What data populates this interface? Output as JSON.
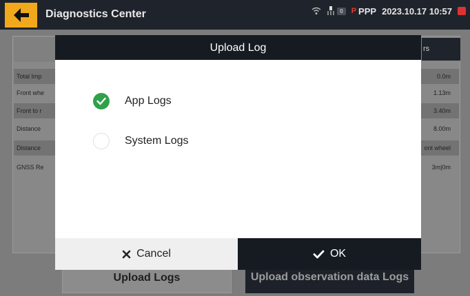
{
  "header": {
    "title": "Diagnostics Center",
    "sat_count": "0",
    "mode": "PPP",
    "ppp_mark": "P",
    "datetime": "2023.10.17 10:57"
  },
  "background": {
    "header_right": "rs",
    "rows": [
      {
        "label": "Total Imp",
        "value": "0.0m"
      },
      {
        "label": "Front whe",
        "value": "1.13m"
      },
      {
        "label": "Front to r",
        "value": "3.40m"
      },
      {
        "label": "Distance",
        "value": "8.00m"
      },
      {
        "label": "Distance",
        "value": "ont wheel"
      },
      {
        "label": "GNSS Re",
        "value": "3m|0m"
      }
    ],
    "upload_logs": "Upload Logs",
    "upload_observation": "Upload observation data Logs"
  },
  "dialog": {
    "title": "Upload Log",
    "options": [
      {
        "label": "App Logs",
        "checked": true
      },
      {
        "label": "System Logs",
        "checked": false
      }
    ],
    "cancel_label": "Cancel",
    "ok_label": "OK"
  },
  "colors": {
    "accent": "#f2a81d",
    "dark": "#161b22",
    "check": "#2fa24a",
    "record": "#dd3333"
  },
  "icons": {
    "back": "arrow-left-icon",
    "wifi": "wifi-icon",
    "satellite": "satellite-icon",
    "record": "record-icon",
    "check": "check-circle-icon",
    "cancel": "close-icon",
    "ok": "checkmark-icon"
  }
}
